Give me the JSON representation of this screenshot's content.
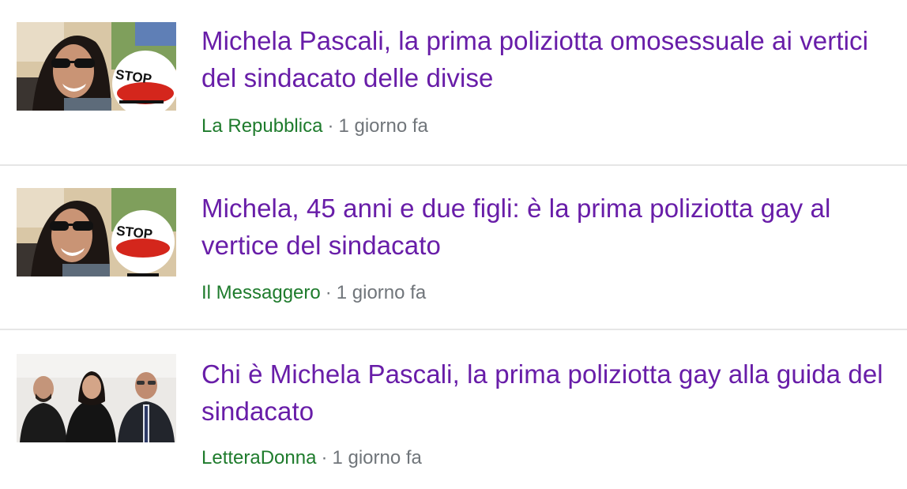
{
  "results": [
    {
      "headline": "Michela Pascali, la prima poliziotta omosessuale ai vertici del sindacato delle divise",
      "source": "La Repubblica",
      "separator": "·",
      "time": "1 giorno fa",
      "thumbnail": "woman-sunglasses-stop-sign",
      "sign_text": "STOP"
    },
    {
      "headline": "Michela, 45 anni e due figli: è la prima poliziotta gay al vertice del sindacato",
      "source": "Il Messaggero",
      "separator": "·",
      "time": "1 giorno fa",
      "thumbnail": "woman-sunglasses-stop-sign",
      "sign_text": "STOP"
    },
    {
      "headline": "Chi è Michela Pascali, la prima poliziotta gay alla guida del sindacato",
      "source": "LetteraDonna",
      "separator": "·",
      "time": "1 giorno fa",
      "thumbnail": "three-people-group-photo"
    }
  ],
  "colors": {
    "headline": "#681da8",
    "source": "#1e7b2c",
    "meta": "#70757a",
    "divider": "#e6e6e6"
  }
}
